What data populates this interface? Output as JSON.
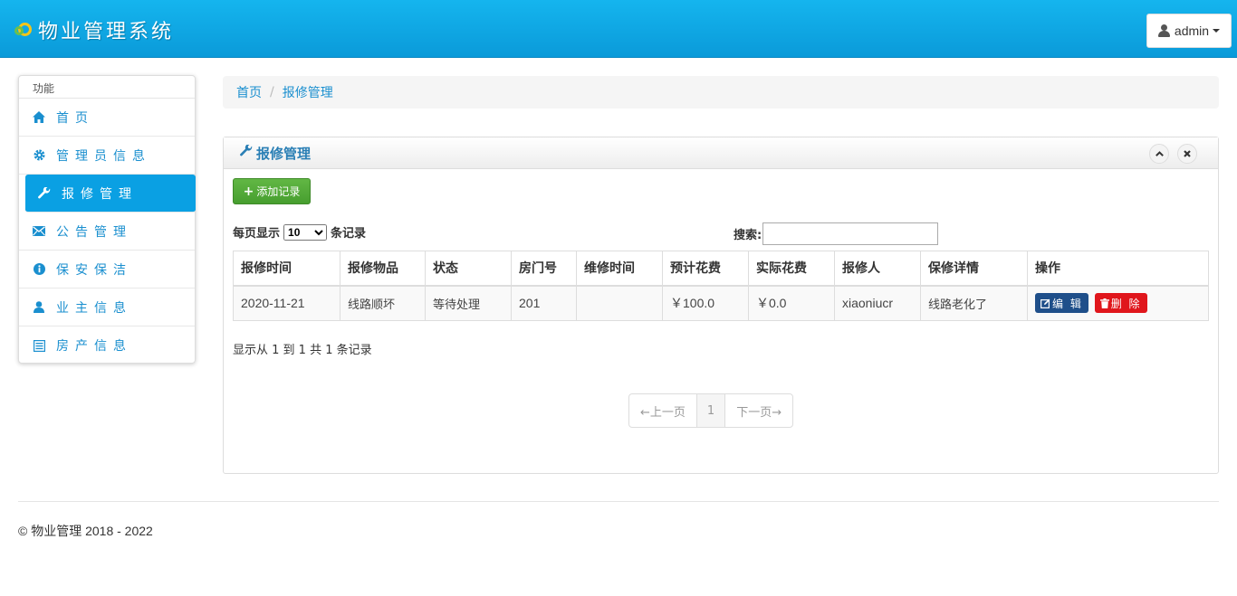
{
  "header": {
    "app_title": "物业管理系统",
    "user": "admin"
  },
  "sidebar": {
    "heading": "功能",
    "items": [
      {
        "label": "首页",
        "icon": "home-icon"
      },
      {
        "label": "管理员信息",
        "icon": "gear-icon"
      },
      {
        "label": "报修管理",
        "icon": "wrench-icon"
      },
      {
        "label": "公告管理",
        "icon": "envelope-icon"
      },
      {
        "label": "保安保洁",
        "icon": "info-icon"
      },
      {
        "label": "业主信息",
        "icon": "user-icon"
      },
      {
        "label": "房产信息",
        "icon": "list-icon"
      }
    ],
    "active_index": 2
  },
  "breadcrumb": {
    "home": "首页",
    "current": "报修管理"
  },
  "panel": {
    "title": "报修管理",
    "add_button": "添加记录",
    "length_prefix": "每页显示",
    "length_value": "10",
    "length_suffix": "条记录",
    "search_label": "搜索:",
    "search_value": "",
    "info": "显示从 1 到 1 共 1 条记录"
  },
  "table": {
    "columns": [
      "报修时间",
      "报修物品",
      "状态",
      "房门号",
      "维修时间",
      "预计花费",
      "实际花费",
      "报修人",
      "保修详情",
      "操作"
    ],
    "rows": [
      {
        "cells": [
          "2020-11-21",
          "线路顺坏",
          "等待处理",
          "201",
          "",
          "￥100.0",
          "￥0.0",
          "xiaoniucr",
          "线路老化了"
        ],
        "edit_label": "编 辑",
        "delete_label": "删 除"
      }
    ]
  },
  "pagination": {
    "prev": "←上一页",
    "current": "1",
    "next": "下一页→"
  },
  "footer": {
    "text": "© 物业管理 2018 - 2022"
  },
  "colors": {
    "header": "#0aa0e3",
    "link": "#1a8fcf",
    "add_button": "#52a83a",
    "edit_button": "#1f4f8a",
    "delete_button": "#e0161c"
  }
}
